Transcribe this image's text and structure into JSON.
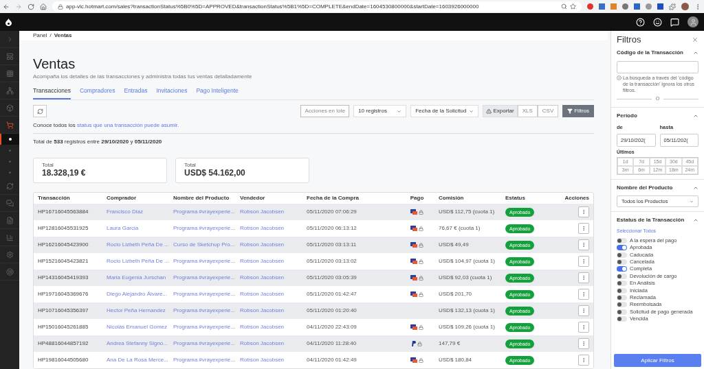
{
  "browser": {
    "url": "app-vlc.hotmart.com/sales?transactionStatus%5B0%5D=APPROVED&transactionStatus%5B1%5D=COMPLETE&endDate=1604530800000&startDate=1603926000000"
  },
  "sidebar": {
    "items": [
      {
        "kind": "chevron",
        "selected": false
      },
      {
        "kind": "panel",
        "selected": false
      },
      {
        "kind": "grid",
        "selected": false
      },
      {
        "kind": "network",
        "selected": false
      },
      {
        "kind": "box",
        "selected": false
      },
      {
        "kind": "cart",
        "selected": true
      },
      {
        "kind": "dot",
        "selected": true
      },
      {
        "kind": "dot",
        "selected": false
      },
      {
        "kind": "dot",
        "selected": false
      },
      {
        "kind": "dot",
        "selected": false
      },
      {
        "kind": "sync",
        "selected": false
      },
      {
        "kind": "chat",
        "selected": false
      },
      {
        "kind": "doc",
        "selected": false
      },
      {
        "kind": "chart",
        "selected": false
      },
      {
        "kind": "gear",
        "selected": false
      },
      {
        "kind": "help",
        "selected": false
      }
    ]
  },
  "breadcrumb": [
    "Panel",
    "/",
    "Ventas"
  ],
  "page": {
    "title": "Ventas",
    "subtitle": "Acompaña los detalles de las transacciones y administra todas tus ventas detalladamente"
  },
  "tabs": [
    {
      "label": "Transacciones",
      "selected": true
    },
    {
      "label": "Compradores",
      "selected": false
    },
    {
      "label": "Entradas",
      "selected": false
    },
    {
      "label": "Invitaciones",
      "selected": false
    },
    {
      "label": "Pago Inteligente",
      "selected": false
    }
  ],
  "toolbar": {
    "batch": "Acciones en lote",
    "per_page": "10 registros",
    "sort": "Fecha de la Solicitud",
    "export": "Exportar",
    "formats": [
      "XLS",
      "CSV"
    ],
    "filters": "Filtros"
  },
  "info": {
    "prefix": "Conoce todos los",
    "link": "status que una transacción puede asumir."
  },
  "summary": "Total de **533** registros entre **29/10/2020** y **05/11/2020**",
  "totals": [
    {
      "label": "Total",
      "value": "18.328,19 €"
    },
    {
      "label": "Total",
      "value": "USD$ 54.162,00"
    }
  ],
  "table": {
    "columns": [
      "Transacción",
      "Comprador",
      "Nombre del Producto",
      "Vendedor",
      "Fecha de la Compra",
      "Pago",
      "Comisión",
      "Estatus",
      "Acciones"
    ],
    "rows": [
      {
        "id": "HP16716045563884",
        "buyer": "Francisco Diaz",
        "product": "Programa #vrayexperie...",
        "seller": "Robson Jacobsen",
        "date": "05/11/2020 07:06:29",
        "kind": "card",
        "commission": "USD$ 112,75 (cuota 1)",
        "status": "Aprobado"
      },
      {
        "id": "HP12816045531925",
        "buyer": "Laura Garcia",
        "product": "Programa #vrayexperie...",
        "seller": "Robson Jacobsen",
        "date": "05/11/2020 06:13:12",
        "kind": "card",
        "commission": "76,67 € (cuota 1)",
        "status": "Aprobado"
      },
      {
        "id": "HP16216045423900",
        "buyer": "Rocio Lizbeth Peña De ...",
        "product": "Curso de Sketchup Pro...",
        "seller": "Robson Jacobsen",
        "date": "05/11/2020 03:13:11",
        "kind": "card",
        "commission": "USD$ 49,49",
        "status": "Aprobado"
      },
      {
        "id": "HP15216045423821",
        "buyer": "Rocio Lizbeth Peña De ...",
        "product": "Programa #vrayexperie...",
        "seller": "Robson Jacobsen",
        "date": "05/11/2020 03:13:02",
        "kind": "card",
        "commission": "USD$ 104,97 (cuota 1)",
        "status": "Aprobado"
      },
      {
        "id": "HP14316045419393",
        "buyer": "Maria Eugenia Jurschan",
        "product": "Programa #vrayexperie...",
        "seller": "Robson Jacobsen",
        "date": "05/11/2020 03:05:39",
        "kind": "card",
        "commission": "USD$ 92,03 (cuota 1)",
        "status": "Aprobado"
      },
      {
        "id": "HP19716045369676",
        "buyer": "Diego Alejandro Álvare...",
        "product": "Programa #vrayexperie...",
        "seller": "Robson Jacobsen",
        "date": "05/11/2020 01:42:47",
        "kind": "card",
        "commission": "USD$ 201,70",
        "status": "Aprobado"
      },
      {
        "id": "HP10716045356397",
        "buyer": "Hector Peña Hernandez",
        "product": "Programa #vrayexperie...",
        "seller": "Robson Jacobsen",
        "date": "05/11/2020 01:20:40",
        "kind": "none",
        "commission": "USD$ 132,13 (cuota 1)",
        "status": "Aprobado"
      },
      {
        "id": "HP15016045261885",
        "buyer": "Nicolás Emanuel Gomez",
        "product": "Programa #vrayexperie...",
        "seller": "Robson Jacobsen",
        "date": "04/11/2020 22:43:09",
        "kind": "card",
        "commission": "USD$ 109,26 (cuota 1)",
        "status": "Aprobado"
      },
      {
        "id": "HP48816044857192",
        "buyer": "Andrea Stefanny Signo...",
        "product": "Programa #vrayexperie...",
        "seller": "Robson Jacobsen",
        "date": "04/11/2020 11:28:40",
        "kind": "paypal",
        "commission": "147,79 €",
        "status": "Aprobado"
      },
      {
        "id": "HP19816044505680",
        "buyer": "Ana De La Rosa Merce...",
        "product": "Programa #vrayexperie...",
        "seller": "Robson Jacobsen",
        "date": "04/11/2020 01:42:49",
        "kind": "card",
        "commission": "USD$ 180,84",
        "status": "Aprobado"
      }
    ]
  },
  "filters": {
    "title": "Filtros",
    "code": {
      "title": "Código de la Transacción",
      "hint": "La búsqueda a través del 'código de la transacción' ignora los otros filtros.",
      "separator": "O"
    },
    "period": {
      "title": "Período",
      "from_label": "de",
      "from": "29/10/202(",
      "to_label": "hasta",
      "to": "05/11/202(",
      "recent_label": "Últimos",
      "ranges": [
        "1d",
        "7d",
        "15d",
        "30d",
        "45d",
        "3m",
        "6m",
        "12m",
        "18m",
        "24m"
      ]
    },
    "product": {
      "title": "Nombre del Producto",
      "value": "Todos los Productos"
    },
    "status": {
      "title": "Estatus de la Transacción",
      "select_all": "Seleccionar Todos",
      "options": [
        {
          "label": "A la espera del pago",
          "on": false
        },
        {
          "label": "Aprobada",
          "on": true
        },
        {
          "label": "Caducada",
          "on": false
        },
        {
          "label": "Cancelada",
          "on": false
        },
        {
          "label": "Completa",
          "on": true
        },
        {
          "label": "Devolución de cargo",
          "on": false
        },
        {
          "label": "En Análisis",
          "on": false
        },
        {
          "label": "Iniciada",
          "on": false
        },
        {
          "label": "Reclamada",
          "on": false
        },
        {
          "label": "Reembolsada",
          "on": false
        },
        {
          "label": "Solicitud de pago generada",
          "on": false
        },
        {
          "label": "Vencida",
          "on": false
        }
      ]
    },
    "apply": "Aplicar Filtros"
  }
}
